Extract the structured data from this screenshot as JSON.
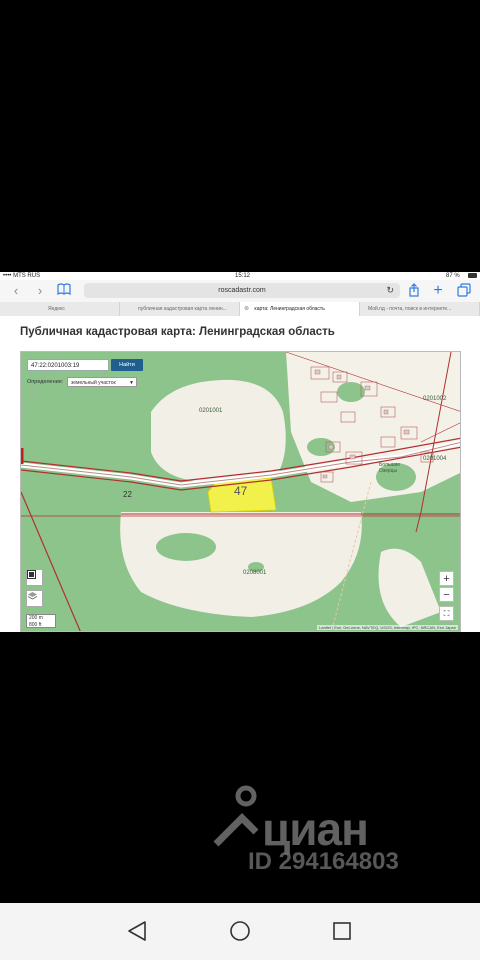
{
  "status_bar": {
    "carrier": "•••• MTS RUS",
    "wifi_icon": "wifi-icon",
    "time": "15:12",
    "battery": "87 %"
  },
  "browser": {
    "url": "roscadastr.com",
    "tabs": [
      "Яндекс",
      "публичная кадастровая карта ленин...",
      "карта: Ленинградская область",
      "Мой.пд - почта, поиск в интернете..."
    ]
  },
  "page": {
    "title": "Публичная кадастровая карта: Ленинградская область"
  },
  "map": {
    "search_value": "47:22:0201003:19",
    "search_button": "Найти",
    "define_label": "Определение:",
    "define_value": "земельный участок",
    "zoom_in": "+",
    "zoom_out": "−",
    "scale_top": "200 m",
    "scale_bottom": "800 ft",
    "labels": {
      "q1": "0201001",
      "q2": "0201002",
      "q3": "0201004",
      "q4": "0208001",
      "r1": "22",
      "village": "Большие Озерцы",
      "parcel": "47"
    },
    "attribution": "Leaflet | Esri, DeLorme, NAVTEQ, USGS, Intermap, iPC, NRCAN, Esri Japan"
  },
  "watermark": {
    "brand": "циан",
    "id": "ID 294164803"
  }
}
